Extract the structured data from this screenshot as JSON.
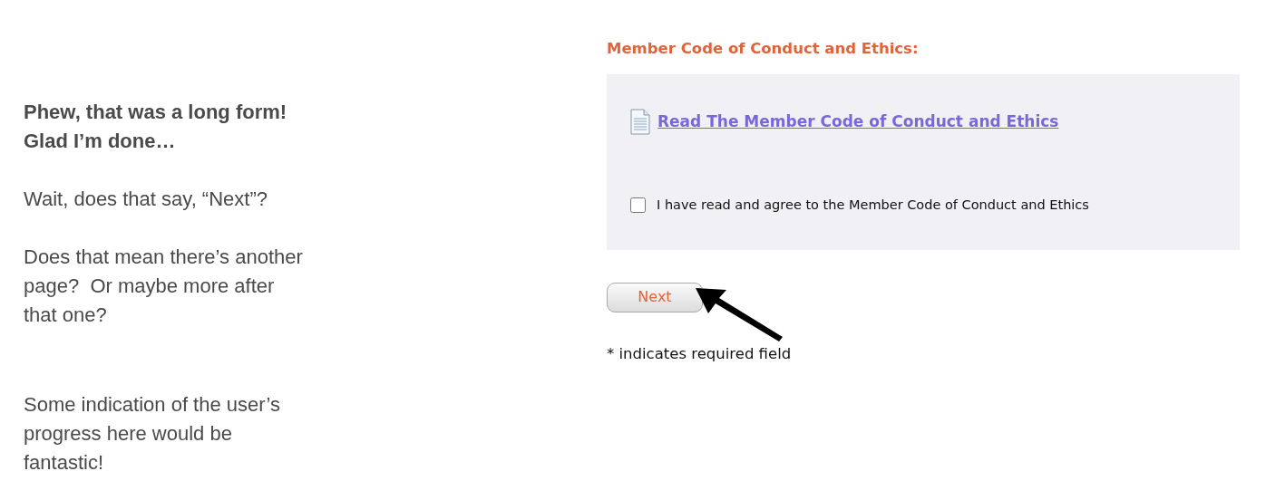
{
  "notes": [
    {
      "lines": [
        "Phew, that was a long form!",
        "Glad I’m done…"
      ],
      "bold": true
    },
    {
      "lines": [
        "Wait, does that say, “Next”?"
      ],
      "bold": false
    },
    {
      "lines": [
        "Does that mean there’s another",
        "page?  Or maybe more after",
        "that one?"
      ],
      "bold": false
    },
    {
      "lines": [
        "Some indication of the user’s",
        "progress here would be",
        "fantastic!"
      ],
      "bold": false
    }
  ],
  "form": {
    "heading": "Member Code of Conduct and Ethics:",
    "link": "Read The Member Code of Conduct and Ethics",
    "agree": {
      "label": "I have read and agree to the Member Code of Conduct and Ethics",
      "checked": false
    },
    "button": "Next",
    "footnote": "* indicates required field"
  }
}
